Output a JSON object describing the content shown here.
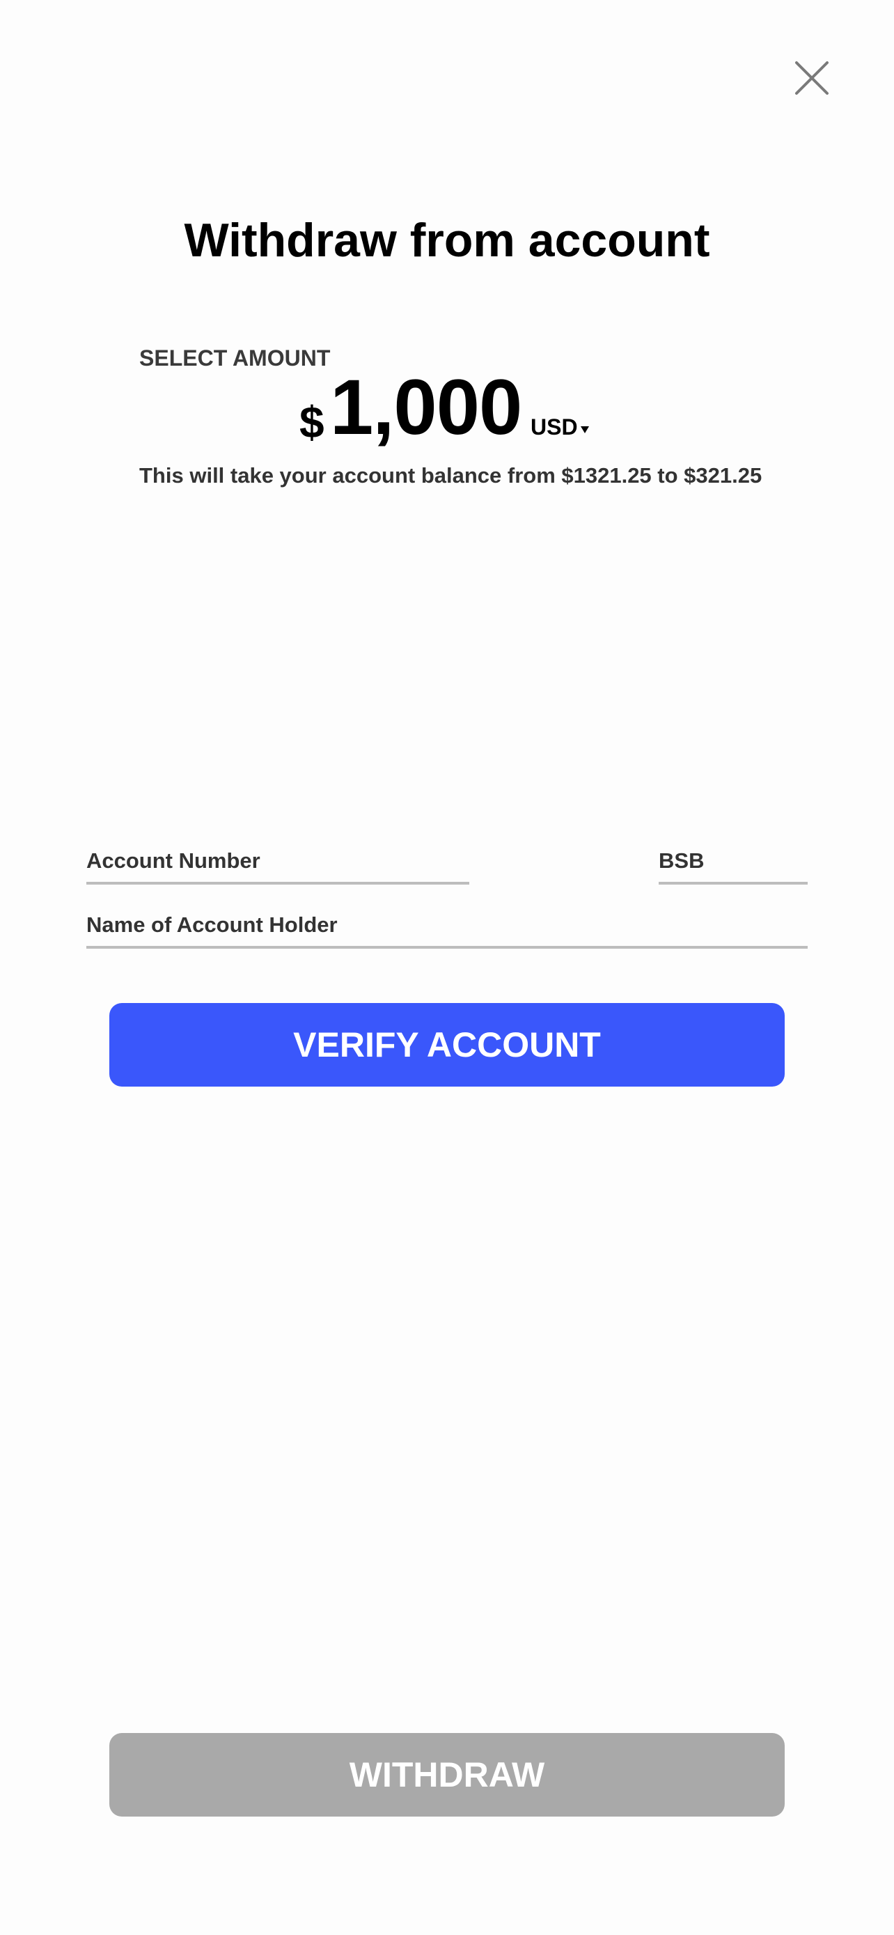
{
  "header": {
    "close_icon": "close-icon",
    "title": "Withdraw from account"
  },
  "amount": {
    "label": "SELECT AMOUNT",
    "currency_symbol": "$",
    "value": "1,000",
    "currency_code": "USD",
    "currency_caret_icon": "caret-down-icon",
    "balance_note": "This will take your account balance from $1321.25 to $321.25"
  },
  "form": {
    "account_number_label": "Account Number",
    "bsb_label": "BSB",
    "account_holder_label": "Name of Account Holder"
  },
  "actions": {
    "verify_label": "VERIFY ACCOUNT",
    "withdraw_label": "WITHDRAW"
  },
  "colors": {
    "primary": "#3a57fb",
    "disabled": "#a9a9a9",
    "field_underline": "#bdbdbd",
    "background": "#fdfdfd"
  }
}
